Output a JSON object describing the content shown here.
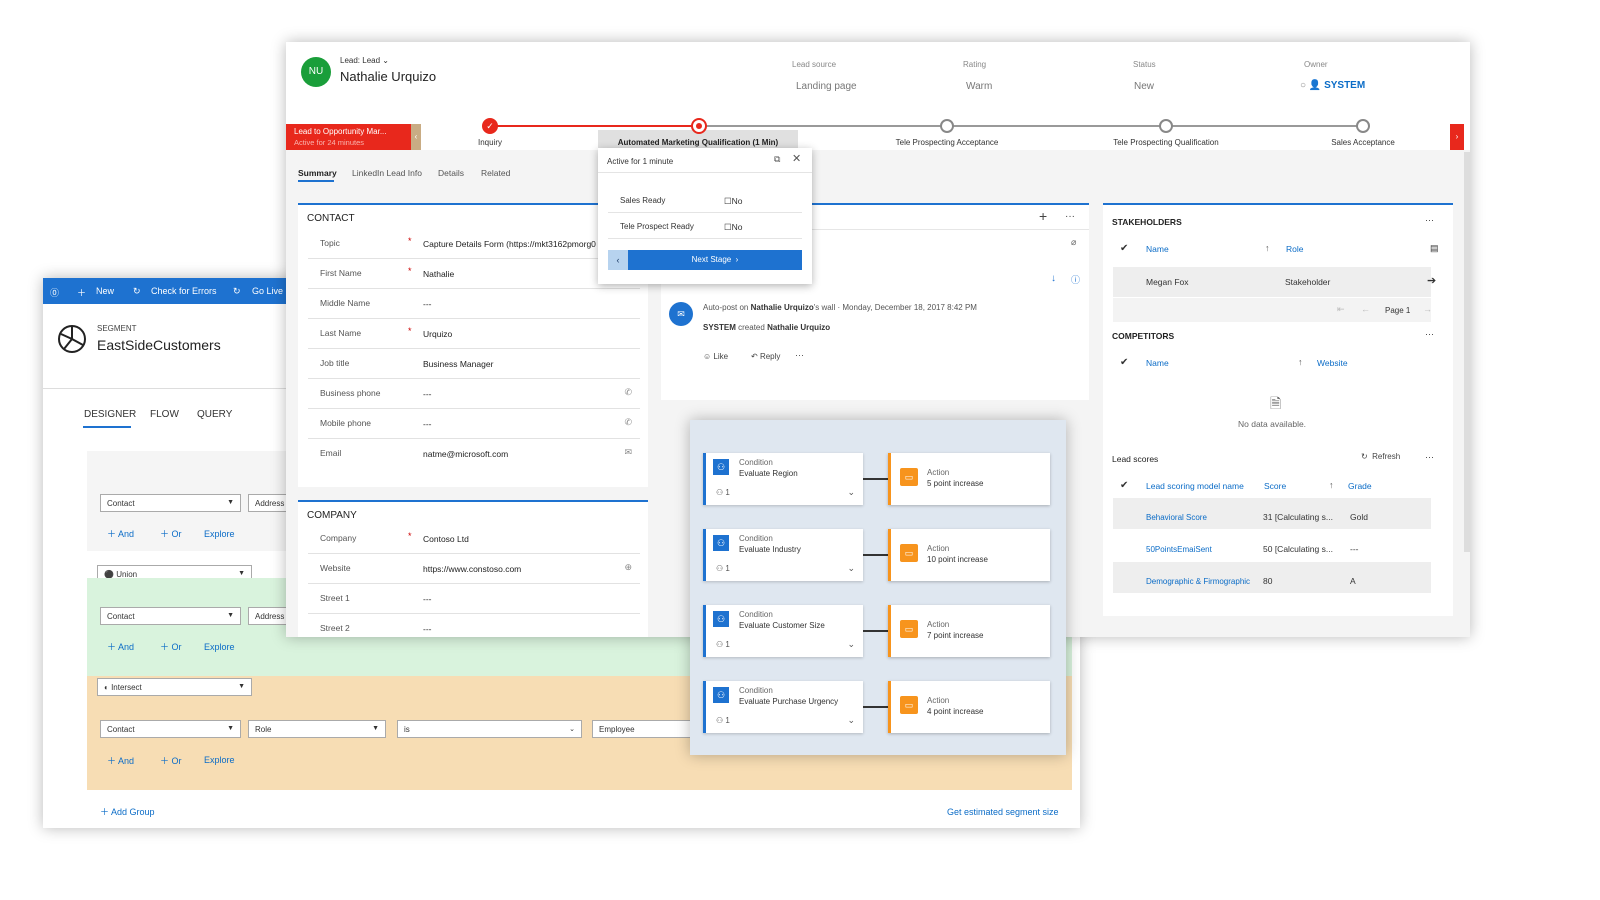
{
  "segment": {
    "cmdbar": {
      "new_label": "New",
      "check_label": "Check for Errors",
      "golive_label": "Go Live"
    },
    "kicker": "SEGMENT",
    "name": "EastSideCustomers",
    "tabs": [
      "DESIGNER",
      "FLOW",
      "QUERY"
    ],
    "group1": {
      "entity": "Contact",
      "field": "Address"
    },
    "union_label": "Union",
    "group2": {
      "entity": "Contact",
      "field": "Address"
    },
    "intersect_label": "Intersect",
    "group3": {
      "entity": "Contact",
      "field": "Role",
      "operator": "is",
      "value": "Employee"
    },
    "and_label": "And",
    "or_label": "Or",
    "explore_label": "Explore",
    "add_group_label": "Add Group",
    "estimate_label": "Get estimated segment size"
  },
  "lead": {
    "avatar": "NU",
    "form_label": "Lead: Lead",
    "name": "Nathalie Urquizo",
    "header_fields": [
      {
        "label": "Lead source",
        "value": "Landing page"
      },
      {
        "label": "Rating",
        "value": "Warm"
      },
      {
        "label": "Status",
        "value": "New"
      },
      {
        "label": "Owner",
        "value": "SYSTEM"
      }
    ],
    "process": {
      "name": "Lead to Opportunity Mar...",
      "active_for": "Active for 24 minutes",
      "stages": [
        "Inquiry",
        "Automated Marketing Qualification  (1 Min)",
        "Tele Prospecting Acceptance",
        "Tele Prospecting Qualification",
        "Sales Acceptance"
      ]
    },
    "flyout": {
      "active": "Active for 1 minute",
      "fields": [
        {
          "label": "Sales Ready",
          "value": "No"
        },
        {
          "label": "Tele Prospect Ready",
          "value": "No"
        }
      ],
      "next_label": "Next Stage"
    },
    "tabs": [
      "Summary",
      "LinkedIn Lead Info",
      "Details",
      "Related"
    ],
    "contact": {
      "title": "CONTACT",
      "fields": [
        {
          "label": "Topic",
          "value": "Capture Details Form (https://mkt3162pmorg0"
        },
        {
          "label": "First Name",
          "value": "Nathalie"
        },
        {
          "label": "Middle Name",
          "value": "---"
        },
        {
          "label": "Last Name",
          "value": "Urquizo"
        },
        {
          "label": "Job title",
          "value": "Business Manager"
        },
        {
          "label": "Business phone",
          "value": "---"
        },
        {
          "label": "Mobile phone",
          "value": "---"
        },
        {
          "label": "Email",
          "value": "natme@microsoft.com"
        }
      ]
    },
    "company": {
      "title": "COMPANY",
      "fields": [
        {
          "label": "Company",
          "value": "Contoso Ltd"
        },
        {
          "label": "Website",
          "value": "https://www.constoso.com"
        },
        {
          "label": "Street 1",
          "value": "---"
        },
        {
          "label": "Street 2",
          "value": "---"
        }
      ]
    },
    "timeline": {
      "post_prefix": "Auto-post on",
      "post_name": "Nathalie Urquizo",
      "post_suffix": "'s wall",
      "post_date": "Monday, December 18, 2017 8:42 PM",
      "post_actor": "SYSTEM",
      "post_verb": "created",
      "post_object": "Nathalie Urquizo",
      "like_label": "Like",
      "reply_label": "Reply"
    },
    "stakeholders": {
      "title": "STAKEHOLDERS",
      "cols": [
        "Name",
        "Role"
      ],
      "rows": [
        {
          "name": "Megan Fox",
          "role": "Stakeholder"
        }
      ],
      "page_label": "Page 1"
    },
    "competitors": {
      "title": "COMPETITORS",
      "cols": [
        "Name",
        "Website"
      ],
      "empty": "No data available."
    },
    "lead_scores": {
      "title": "Lead scores",
      "refresh_label": "Refresh",
      "cols": [
        "Lead scoring model name",
        "Score",
        "Grade"
      ],
      "rows": [
        {
          "name": "Behavioral Score",
          "score": "31 [Calculating s...",
          "grade": "Gold"
        },
        {
          "name": "50PointsEmaiSent",
          "score": "50 [Calculating s...",
          "grade": "---"
        },
        {
          "name": "Demographic & Firmographic",
          "score": "80",
          "grade": "A"
        }
      ]
    }
  },
  "scoring": {
    "condition_label": "Condition",
    "action_label": "Action",
    "rules": [
      {
        "condition": "Evaluate Region",
        "count": "1",
        "action": "5 point increase"
      },
      {
        "condition": "Evaluate Industry",
        "count": "1",
        "action": "10 point increase"
      },
      {
        "condition": "Evaluate Customer Size",
        "count": "1",
        "action": "7 point increase"
      },
      {
        "condition": "Evaluate Purchase Urgency",
        "count": "1",
        "action": "4 point increase"
      }
    ]
  },
  "colors": {
    "accent": "#1e72d0",
    "process_red": "#e8281c",
    "orange": "#f7941d"
  }
}
